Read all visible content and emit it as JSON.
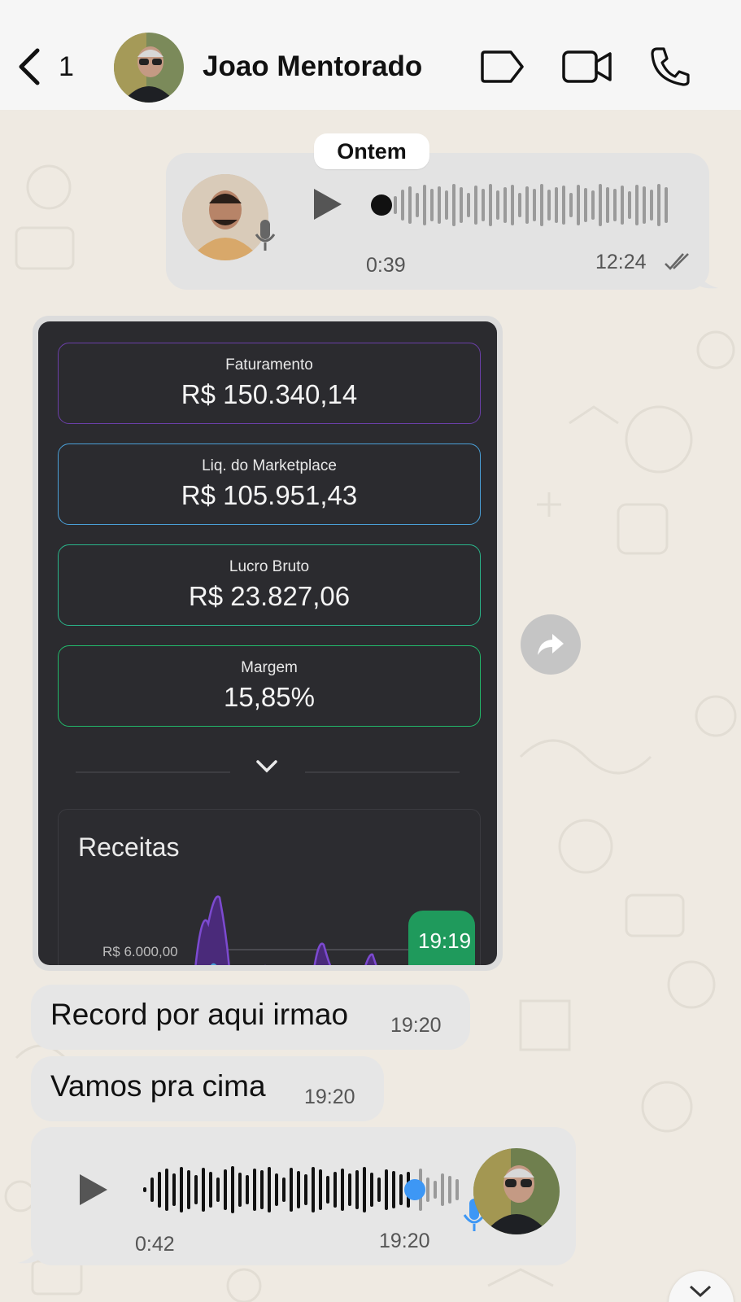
{
  "header": {
    "back_count": "1",
    "contact_name": "Joao Mentorado",
    "icons": [
      "back-chevron-icon",
      "label-tag-icon",
      "video-camera-icon",
      "phone-icon"
    ]
  },
  "chat": {
    "date_separator": "Ontem",
    "messages": [
      {
        "type": "audio",
        "direction": "outgoing",
        "duration": "0:39",
        "time": "12:24",
        "status": "read",
        "progress": 0
      },
      {
        "type": "image",
        "direction": "incoming",
        "time": "19:19",
        "image": {
          "cards": [
            {
              "label": "Faturamento",
              "value": "R$ 150.340,14",
              "border_color": "#6b3fa8"
            },
            {
              "label": "Liq. do Marketplace",
              "value": "R$ 105.951,43",
              "border_color": "#4aa0d8"
            },
            {
              "label": "Lucro Bruto",
              "value": "R$ 23.827,06",
              "border_color": "#2ab58a"
            },
            {
              "label": "Margem",
              "value": "15,85%",
              "border_color": "#22b86a"
            }
          ],
          "chart_title": "Receitas",
          "chart_tick": "R$ 6.000,00"
        }
      },
      {
        "type": "text",
        "direction": "incoming",
        "text": "Record por aqui irmao",
        "time": "19:20"
      },
      {
        "type": "text",
        "direction": "incoming",
        "text": "Vamos pra cima",
        "time": "19:20"
      },
      {
        "type": "audio",
        "direction": "incoming",
        "duration": "0:42",
        "time": "19:20",
        "progress": 0.85
      }
    ]
  },
  "colors": {
    "chat_background": "#efeae2",
    "playhead_blue": "#3d97f5",
    "mic_blue": "#3d97f5",
    "time_badge_green": "#1f9a5c"
  }
}
